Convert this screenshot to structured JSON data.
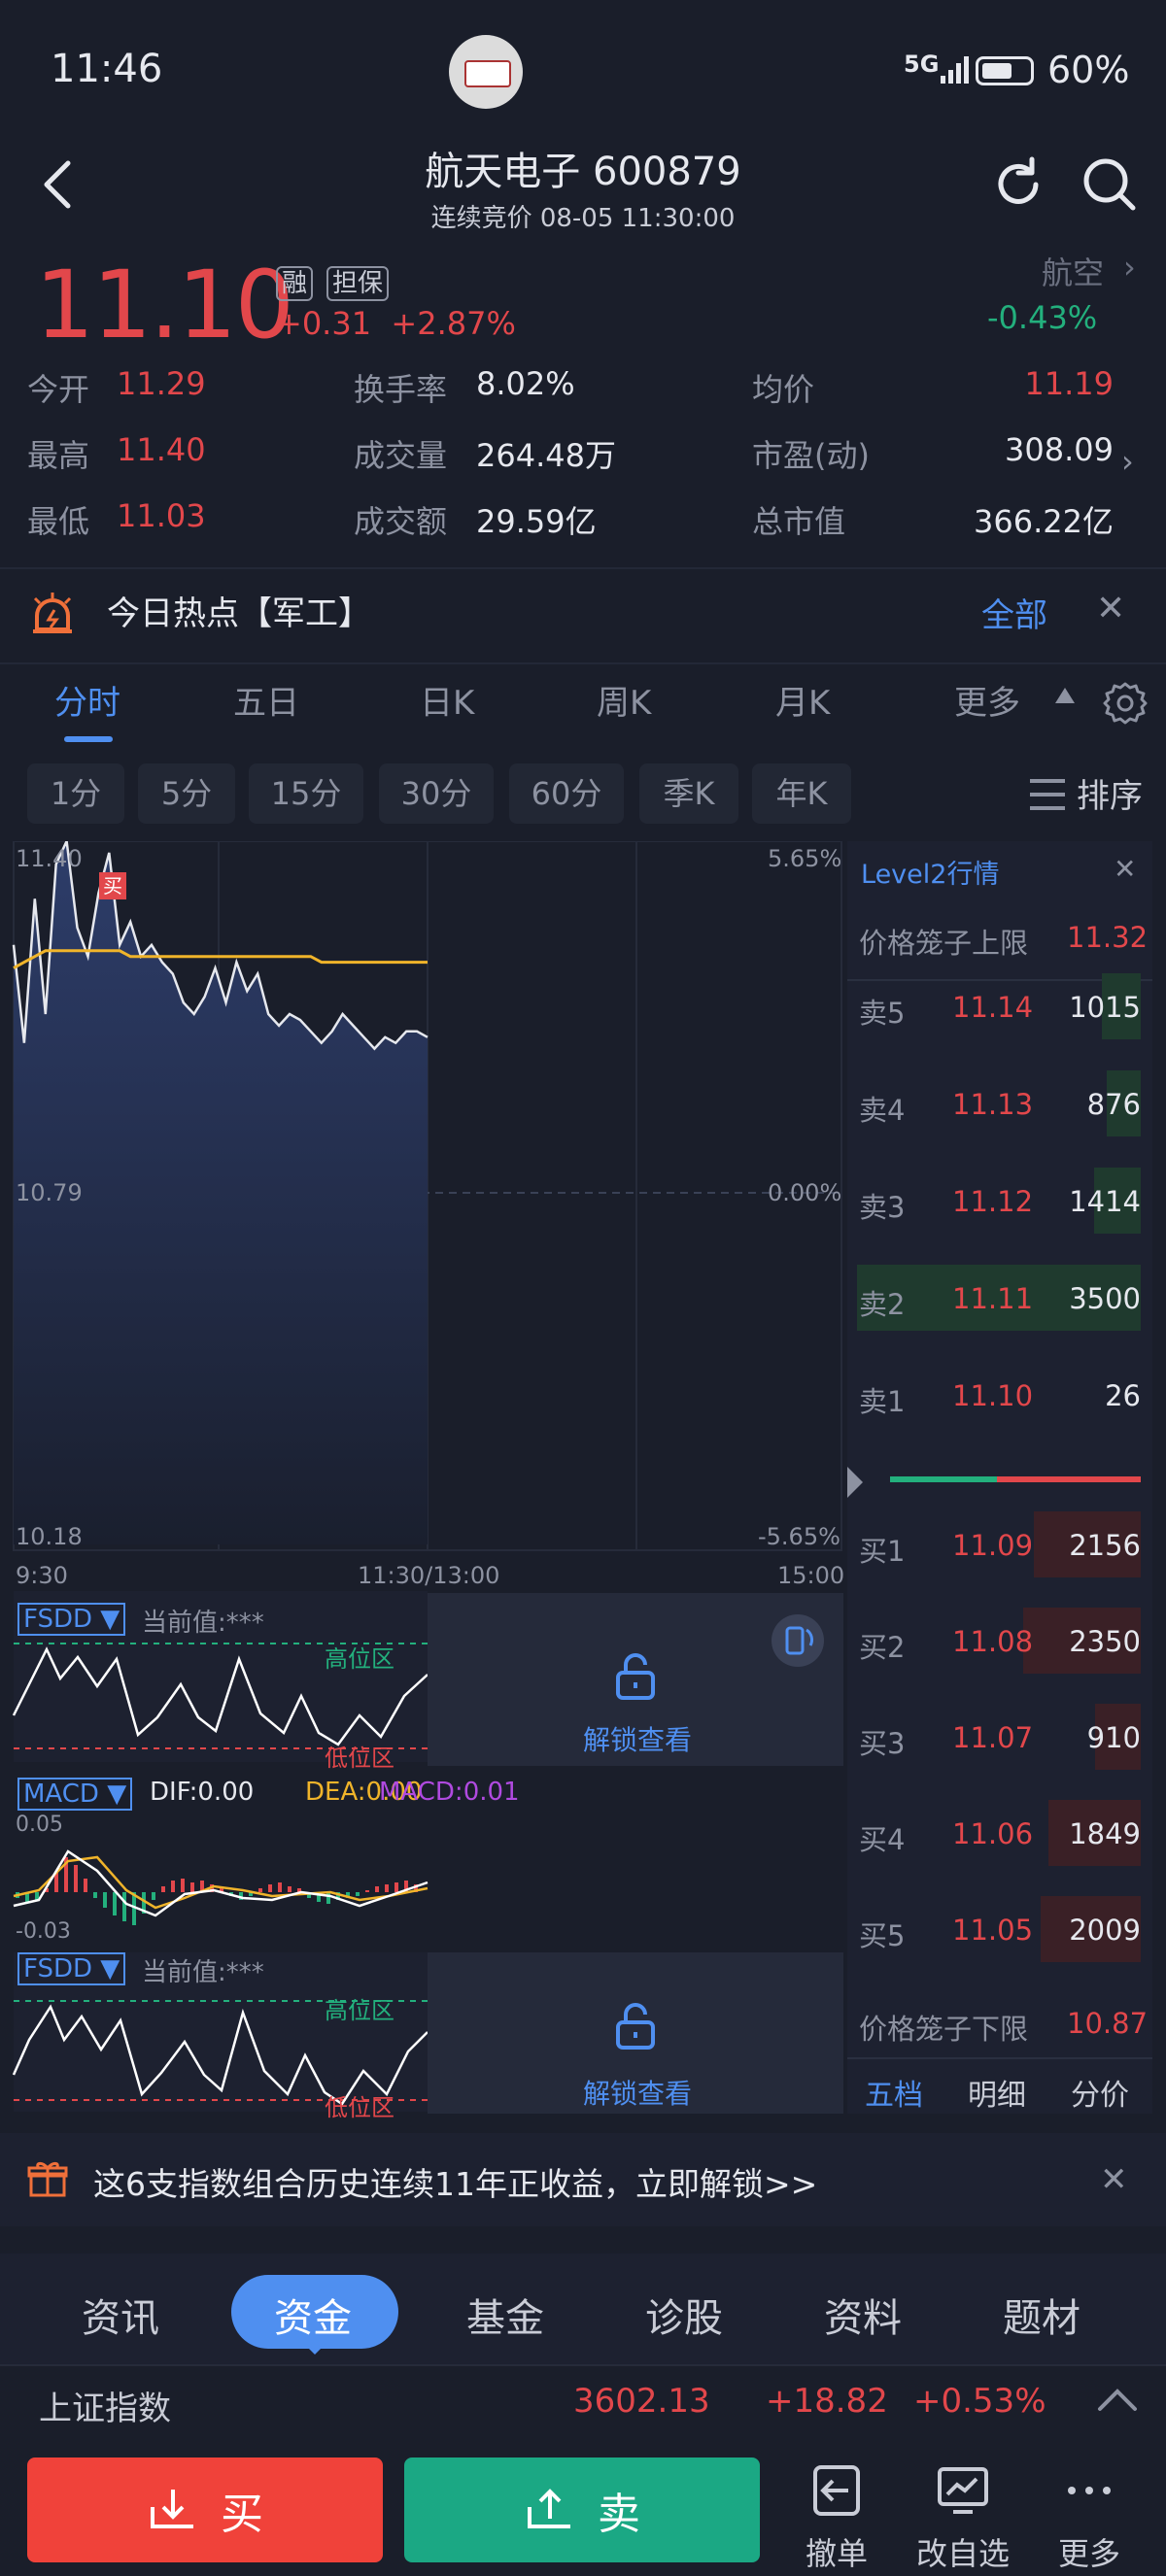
{
  "status": {
    "time": "11:46",
    "network": "5G",
    "battery": "60%"
  },
  "header": {
    "title": "航天电子 600879",
    "subtitle": "连续竞价 08-05 11:30:00"
  },
  "quote": {
    "price": "11.10",
    "tag_margin": "融",
    "tag_guarantee": "担保",
    "change": "+0.31",
    "change_pct": "+2.87%",
    "sector_name": "航空",
    "sector_pct": "-0.43%"
  },
  "stats": [
    {
      "label": "今开",
      "value": "11.29",
      "color": "red"
    },
    {
      "label": "换手率",
      "value": "8.02%",
      "color": "white"
    },
    {
      "label": "均价",
      "value": "11.19",
      "color": "red"
    },
    {
      "label": "最高",
      "value": "11.40",
      "color": "red"
    },
    {
      "label": "成交量",
      "value": "264.48万",
      "color": "white"
    },
    {
      "label": "市盈(动)",
      "value": "308.09",
      "color": "white"
    },
    {
      "label": "最低",
      "value": "11.03",
      "color": "red"
    },
    {
      "label": "成交额",
      "value": "29.59亿",
      "color": "white"
    },
    {
      "label": "总市值",
      "value": "366.22亿",
      "color": "white"
    }
  ],
  "hot": {
    "text": "今日热点【军工】",
    "all": "全部"
  },
  "chart_tabs": [
    "分时",
    "五日",
    "日K",
    "周K",
    "月K",
    "更多"
  ],
  "period_tabs": [
    "1分",
    "5分",
    "15分",
    "30分",
    "60分",
    "季K",
    "年K"
  ],
  "sort_label": "排序",
  "chart": {
    "y_top": "11.40",
    "y_mid": "10.79",
    "y_bot": "10.18",
    "pct_top": "5.65%",
    "pct_mid": "0.00%",
    "pct_bot": "-5.65%",
    "x_start": "9:30",
    "x_mid": "11:30/13:00",
    "x_end": "15:00",
    "buy_mark": "买"
  },
  "chart_data": {
    "type": "line",
    "title": "",
    "series": [
      {
        "name": "price",
        "values": [
          11.22,
          11.05,
          11.3,
          11.1,
          11.36,
          11.4,
          11.25,
          11.2,
          11.31,
          11.38,
          11.22,
          11.26,
          11.2,
          11.22,
          11.19,
          11.17,
          11.12,
          11.1,
          11.13,
          11.18,
          11.12,
          11.19,
          11.14,
          11.17,
          11.1,
          11.08,
          11.1,
          11.09,
          11.07,
          11.05,
          11.07,
          11.1,
          11.08,
          11.06,
          11.04,
          11.06,
          11.05,
          11.07,
          11.07,
          11.06
        ]
      },
      {
        "name": "avg",
        "values": [
          11.18,
          11.19,
          11.2,
          11.21,
          11.21,
          11.21,
          11.21,
          11.21,
          11.21,
          11.21,
          11.21,
          11.2,
          11.2,
          11.2,
          11.2,
          11.2,
          11.2,
          11.2,
          11.2,
          11.2,
          11.2,
          11.2,
          11.2,
          11.2,
          11.2,
          11.2,
          11.2,
          11.2,
          11.2,
          11.19,
          11.19,
          11.19,
          11.19,
          11.19,
          11.19,
          11.19,
          11.19,
          11.19,
          11.19,
          11.19
        ]
      }
    ],
    "ylim": [
      10.18,
      11.4
    ]
  },
  "indicators": {
    "fsdd_name": "FSDD ▼",
    "fsdd_value": "当前值:***",
    "high_zone": "高位区",
    "low_zone": "低位区",
    "unlock": "解锁查看",
    "macd_name": "MACD ▼",
    "dif": "DIF:0.00",
    "dea": "DEA:0.00",
    "macd": "MACD:0.01",
    "macd_top": "0.05",
    "macd_bot": "-0.03"
  },
  "level2": {
    "title": "Level2行情",
    "upper_label": "价格笼子上限",
    "upper_value": "11.32",
    "lower_label": "价格笼子下限",
    "lower_value": "10.87",
    "asks": [
      {
        "label": "卖5",
        "price": "11.14",
        "vol": "1015",
        "fill": 0.33
      },
      {
        "label": "卖4",
        "price": "11.13",
        "vol": "876",
        "fill": 0.29
      },
      {
        "label": "卖3",
        "price": "11.12",
        "vol": "1414",
        "fill": 0.4
      },
      {
        "label": "卖2",
        "price": "11.11",
        "vol": "3500",
        "fill": 1.0
      },
      {
        "label": "卖1",
        "price": "11.10",
        "vol": "26",
        "fill": 0.0
      }
    ],
    "bids": [
      {
        "label": "买1",
        "price": "11.09",
        "vol": "2156",
        "fill": 0.61
      },
      {
        "label": "买2",
        "price": "11.08",
        "vol": "2350",
        "fill": 0.67
      },
      {
        "label": "买3",
        "price": "11.07",
        "vol": "910",
        "fill": 0.26
      },
      {
        "label": "买4",
        "price": "11.06",
        "vol": "1849",
        "fill": 0.53
      },
      {
        "label": "买5",
        "price": "11.05",
        "vol": "2009",
        "fill": 0.57
      }
    ],
    "tabs": [
      "五档",
      "明细",
      "分价"
    ]
  },
  "promo": {
    "text": "这6支指数组合历史连续11年正收益，立即解锁>>"
  },
  "section_tabs": [
    "资讯",
    "资金",
    "基金",
    "诊股",
    "资料",
    "题材"
  ],
  "index": {
    "name": "上证指数",
    "value": "3602.13",
    "change": "+18.82",
    "pct": "+0.53%"
  },
  "actions": {
    "buy": "买",
    "sell": "卖",
    "cancel": "撤单",
    "edit_watch": "改自选",
    "more": "更多"
  },
  "colors": {
    "red": "#e2474b",
    "green": "#23b07d",
    "accent": "#4f8ff0",
    "bg": "#1a1e2a"
  }
}
